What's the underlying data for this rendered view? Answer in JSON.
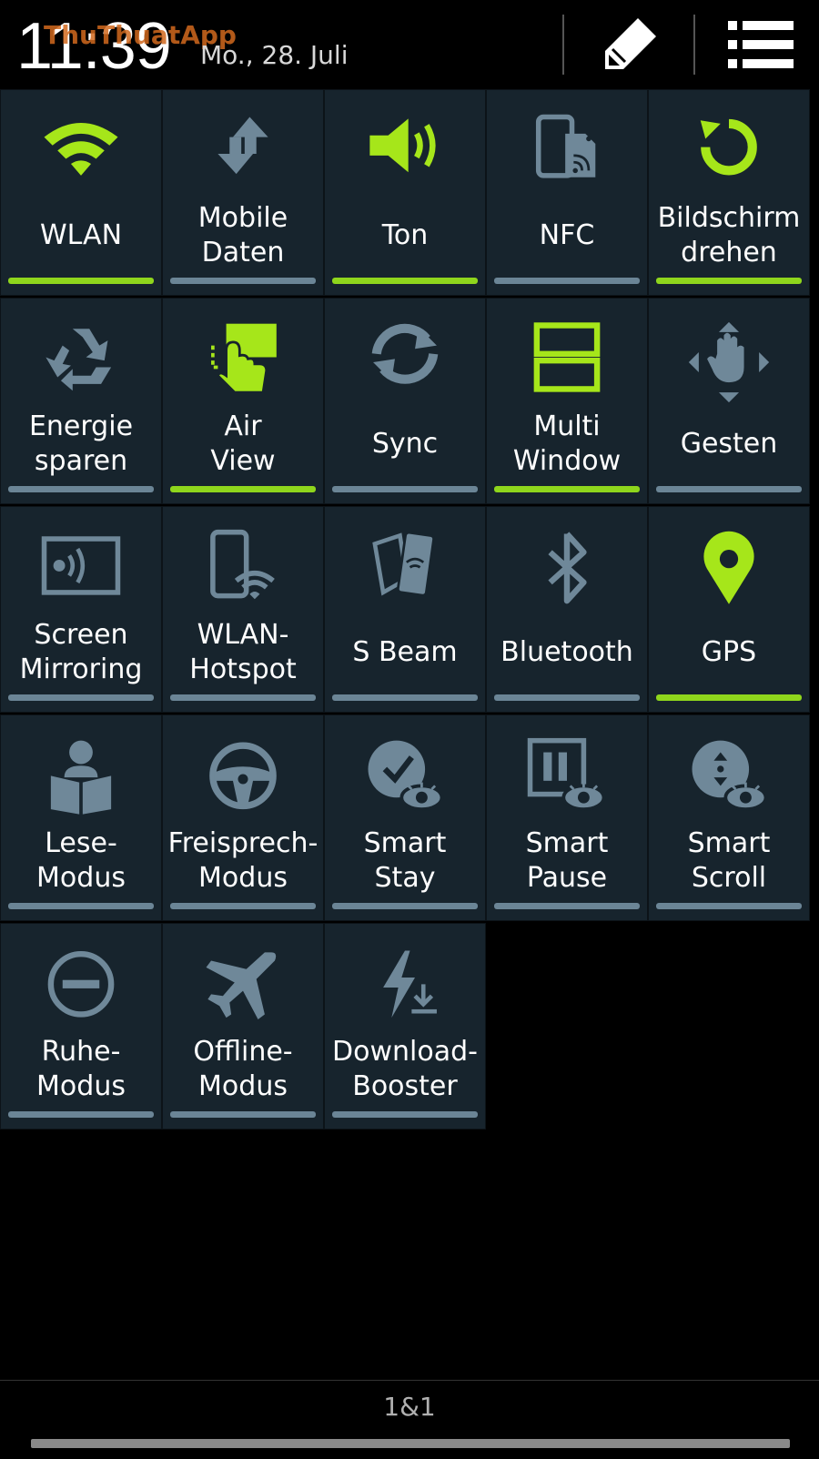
{
  "status": {
    "time": "11:39",
    "date": "Mo., 28. Juli",
    "watermark": "ThuThuatApp"
  },
  "header": {
    "edit_icon": "pencil-icon",
    "list_icon": "list-icon"
  },
  "colors": {
    "active": "#a6e61a",
    "inactive": "#6f8899",
    "tile_bg": "#17242d"
  },
  "tiles": [
    {
      "label": "WLAN",
      "icon": "wifi-icon",
      "active": true
    },
    {
      "label": "Mobile\nDaten",
      "icon": "mobile-data-icon",
      "active": false
    },
    {
      "label": "Ton",
      "icon": "sound-icon",
      "active": true
    },
    {
      "label": "NFC",
      "icon": "nfc-icon",
      "active": false
    },
    {
      "label": "Bildschirm\ndrehen",
      "icon": "rotate-icon",
      "active": true
    },
    {
      "label": "Energie\nsparen",
      "icon": "recycle-icon",
      "active": false
    },
    {
      "label": "Air\nView",
      "icon": "air-view-icon",
      "active": true
    },
    {
      "label": "Sync",
      "icon": "sync-icon",
      "active": false
    },
    {
      "label": "Multi\nWindow",
      "icon": "multi-window-icon",
      "active": true
    },
    {
      "label": "Gesten",
      "icon": "gesture-icon",
      "active": false
    },
    {
      "label": "Screen\nMirroring",
      "icon": "screen-mirroring-icon",
      "active": false
    },
    {
      "label": "WLAN-\nHotspot",
      "icon": "hotspot-icon",
      "active": false
    },
    {
      "label": "S Beam",
      "icon": "s-beam-icon",
      "active": false
    },
    {
      "label": "Bluetooth",
      "icon": "bluetooth-icon",
      "active": false
    },
    {
      "label": "GPS",
      "icon": "gps-pin-icon",
      "active": true
    },
    {
      "label": "Lese-\nModus",
      "icon": "reading-icon",
      "active": false
    },
    {
      "label": "Freisprech-\nModus",
      "icon": "steering-wheel-icon",
      "active": false
    },
    {
      "label": "Smart\nStay",
      "icon": "smart-stay-icon",
      "active": false
    },
    {
      "label": "Smart\nPause",
      "icon": "smart-pause-icon",
      "active": false
    },
    {
      "label": "Smart\nScroll",
      "icon": "smart-scroll-icon",
      "active": false
    },
    {
      "label": "Ruhe-\nModus",
      "icon": "do-not-disturb-icon",
      "active": false
    },
    {
      "label": "Offline-\nModus",
      "icon": "airplane-icon",
      "active": false
    },
    {
      "label": "Download-\nBooster",
      "icon": "download-booster-icon",
      "active": false
    }
  ],
  "footer": {
    "carrier": "1&1"
  }
}
